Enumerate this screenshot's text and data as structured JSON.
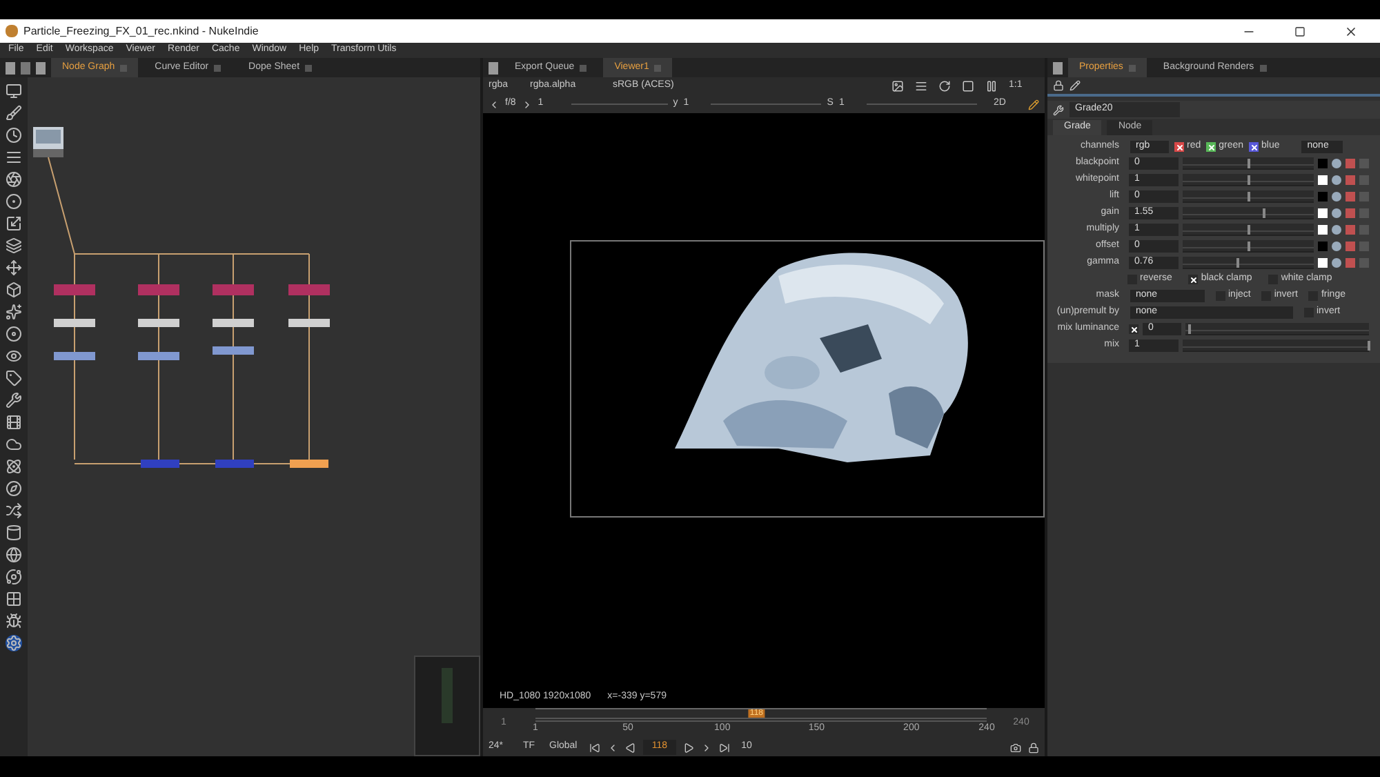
{
  "window": {
    "title": "Particle_Freezing_FX_01_rec.nkind - NukeIndie"
  },
  "menu": [
    "File",
    "Edit",
    "Workspace",
    "Viewer",
    "Render",
    "Cache",
    "Window",
    "Help",
    "Transform Utils"
  ],
  "node_graph": {
    "tabs": [
      {
        "label": "Node Graph",
        "selected": true
      },
      {
        "label": "Curve Editor",
        "selected": false
      },
      {
        "label": "Dope Sheet",
        "selected": false
      }
    ]
  },
  "viewer": {
    "tabs": [
      {
        "label": "Export Queue",
        "selected": false
      },
      {
        "label": "Viewer1",
        "selected": true
      }
    ],
    "channels": "rgba",
    "alpha": "rgba.alpha",
    "colorspace": "sRGB (ACES)",
    "zoom": "1:1",
    "view_mode": "2D",
    "fstop": "f/8",
    "frame_field": "1",
    "gamma_label": "y",
    "gamma_value": "1",
    "saturation_label": "S",
    "saturation_value": "1",
    "format": "HD_1080 1920x1080",
    "coords": "x=-339 y=579",
    "timeline": {
      "in": "1",
      "out": "240",
      "ticks": [
        "1",
        "50",
        "100",
        "150",
        "200",
        "240"
      ],
      "current": "118",
      "level": 0.49
    },
    "fps": "24*",
    "tf": "TF",
    "scope": "Global",
    "frame": "118",
    "step": "10"
  },
  "properties": {
    "tabs": [
      {
        "label": "Properties",
        "selected": true
      },
      {
        "label": "Background Renders",
        "selected": false
      }
    ],
    "node_name": "Grade20",
    "subtabs": [
      {
        "label": "Grade",
        "selected": true
      },
      {
        "label": "Node",
        "selected": false
      }
    ],
    "channels": {
      "label": "channels",
      "value": "rgb",
      "extra": "none",
      "items": [
        {
          "label": "red",
          "checked": true,
          "color": "#d84848"
        },
        {
          "label": "green",
          "checked": true,
          "color": "#58b858"
        },
        {
          "label": "blue",
          "checked": true,
          "color": "#5858d8"
        }
      ]
    },
    "knobs": [
      {
        "label": "blackpoint",
        "value": "0",
        "color": "#000000",
        "level": 0.5
      },
      {
        "label": "whitepoint",
        "value": "1",
        "color": "#ffffff",
        "level": 0.5
      },
      {
        "label": "lift",
        "value": "0",
        "color": "#000000",
        "level": 0.5
      },
      {
        "label": "gain",
        "value": "1.55",
        "color": "#ffffff",
        "level": 0.62
      },
      {
        "label": "multiply",
        "value": "1",
        "color": "#ffffff",
        "level": 0.5
      },
      {
        "label": "offset",
        "value": "0",
        "color": "#000000",
        "level": 0.5
      },
      {
        "label": "gamma",
        "value": "0.76",
        "color": "#ffffff",
        "level": 0.42
      }
    ],
    "clamps": [
      {
        "label": "reverse",
        "checked": false
      },
      {
        "label": "black clamp",
        "checked": true
      },
      {
        "label": "white clamp",
        "checked": false
      }
    ],
    "mask": {
      "label": "mask",
      "value": "none",
      "options": [
        {
          "label": "inject",
          "checked": false
        },
        {
          "label": "invert",
          "checked": false
        },
        {
          "label": "fringe",
          "checked": false
        }
      ]
    },
    "premult": {
      "label": "(un)premult by",
      "value": "none",
      "options": [
        {
          "label": "invert",
          "checked": false
        }
      ]
    },
    "mix_luminance": {
      "label": "mix luminance",
      "checked": true,
      "value": "0",
      "level": 0.02
    },
    "mix": {
      "label": "mix",
      "value": "1",
      "level": 1
    }
  }
}
